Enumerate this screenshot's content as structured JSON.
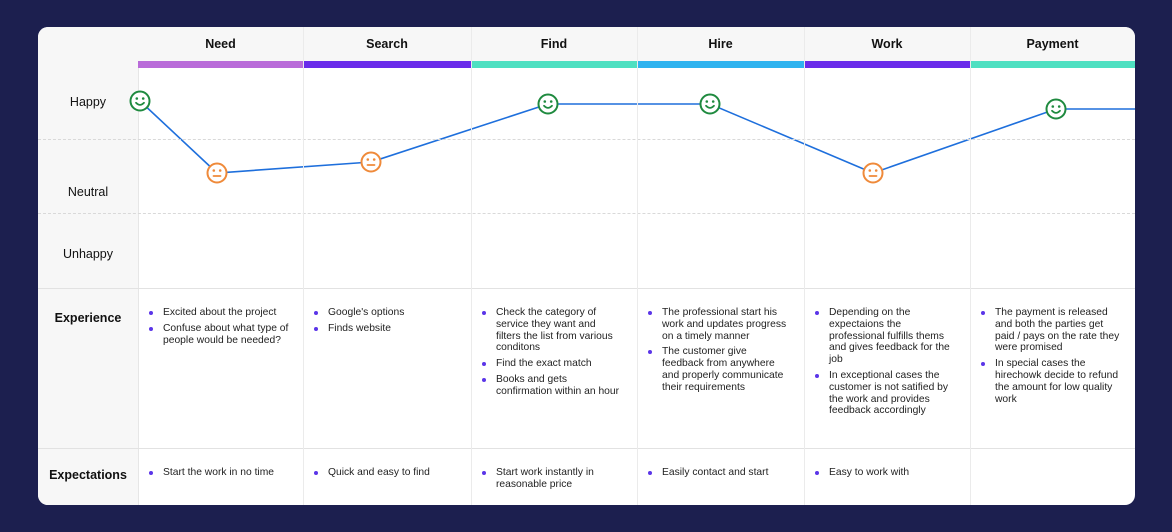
{
  "rows": {
    "happy": "Happy",
    "neutral": "Neutral",
    "unhappy": "Unhappy",
    "experience": "Experience",
    "expectations": "Expectations"
  },
  "stages": [
    {
      "name": "Need",
      "color": "#b96bd9"
    },
    {
      "name": "Search",
      "color": "#6a2bea"
    },
    {
      "name": "Find",
      "color": "#4ee0c1"
    },
    {
      "name": "Hire",
      "color": "#2fb3ef"
    },
    {
      "name": "Work",
      "color": "#6a2bea"
    },
    {
      "name": "Payment",
      "color": "#4ee0c1"
    }
  ],
  "emotion_curve": {
    "line_color": "#1e6fdc",
    "happy_color": "#1f8a3f",
    "neutral_color": "#ef8a3a",
    "points": [
      "happy",
      "neutral",
      "neutral",
      "happy",
      "happy",
      "neutral",
      "happy",
      "happy"
    ]
  },
  "experience": [
    [
      "Excited about the project",
      "Confuse about what type of people would be needed?"
    ],
    [
      "Google's options",
      "Finds website"
    ],
    [
      "Check the category of service they want and filters the list from various conditons",
      "Find the exact match",
      "Books and gets confirmation within an hour"
    ],
    [
      "The professional start his work and updates progress on a timely manner",
      "The customer give feedback from anywhere and properly communicate their requirements"
    ],
    [
      "Depending on the expectaions the professional fulfills thems and gives feedback for the job",
      "In exceptional cases the customer is not satified by the work and provides feedback accordingly"
    ],
    [
      "The payment is released and both the parties get paid / pays on the rate they were promised",
      "In special cases the hirechowk decide to refund the amount for low quality work"
    ]
  ],
  "expectations": [
    [
      "Start the work in no time"
    ],
    [
      "Quick and easy to find"
    ],
    [
      "Start work instantly in reasonable price"
    ],
    [
      "Easily contact and start"
    ],
    [
      "Easy to work with"
    ],
    []
  ]
}
